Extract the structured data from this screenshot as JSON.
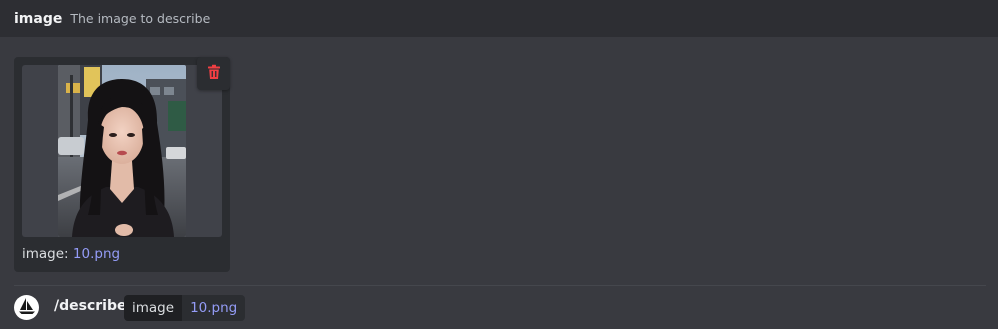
{
  "option": {
    "name": "image",
    "description": "The image to describe"
  },
  "attachment": {
    "label_prefix": "image:",
    "filename": "10.png",
    "delete_icon": "trash-icon",
    "delete_color": "#f23f43"
  },
  "command": {
    "name": "/describe",
    "avatar_icon": "sailboat-logo-icon",
    "param_name": "image",
    "param_value": "10.png"
  },
  "colors": {
    "accent_link": "#949cf7",
    "background": "#393a40",
    "header": "#2d2e33"
  }
}
